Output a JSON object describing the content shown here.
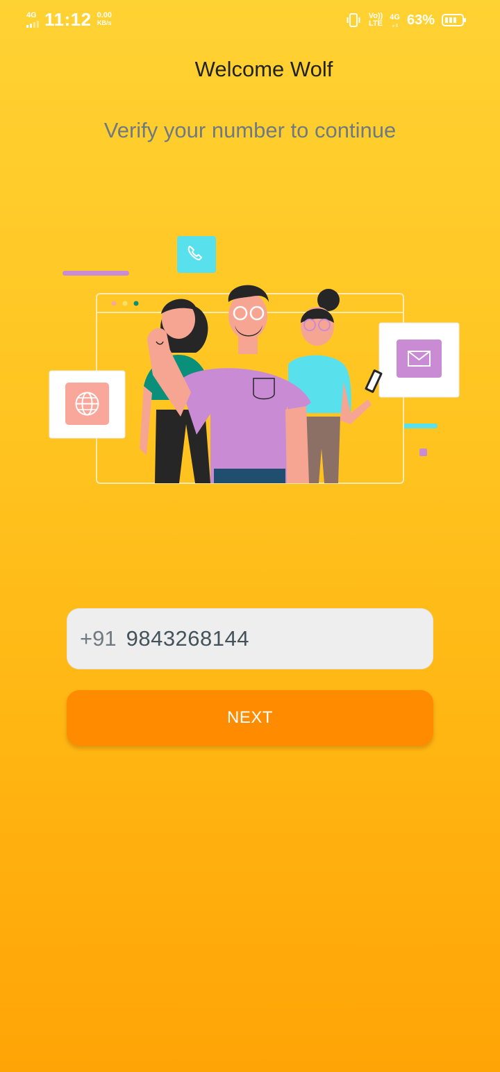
{
  "status_bar": {
    "network_left": "4G",
    "time": "11:12",
    "speed_value": "0.00",
    "speed_unit": "KB/s",
    "volte_top": "Vo))",
    "volte_bottom": "LTE",
    "network_right": "4G",
    "battery_percent": "63%",
    "icons": [
      "signal-icon",
      "vibrate-icon",
      "battery-icon"
    ]
  },
  "header": {
    "title": "Welcome Wolf",
    "subtitle": "Verify your number to continue"
  },
  "illustration": {
    "icons": [
      "phone-call-icon",
      "globe-icon",
      "mail-icon"
    ],
    "colors": {
      "cyan": "#58E0EC",
      "purple": "#C98BD4",
      "salmon": "#F8A79A",
      "skin": "#F7A593",
      "dark": "#262626",
      "teal": "#0A8F7A"
    }
  },
  "form": {
    "country_code": "+91",
    "phone_value": "9843268144",
    "next_label": "NEXT"
  },
  "colors": {
    "accent": "#FF8C00",
    "background_top": "#FFD233",
    "background_bottom": "#FFA406",
    "field_bg": "#EEEEEE"
  }
}
